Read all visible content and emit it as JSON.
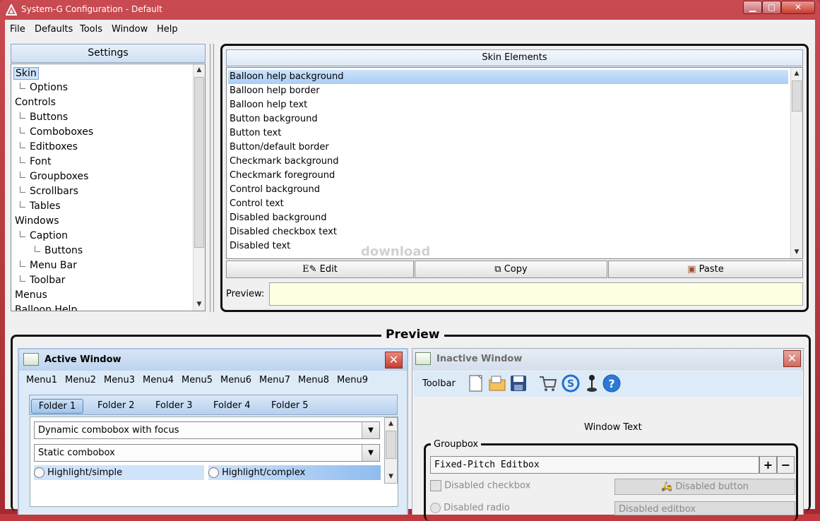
{
  "window": {
    "title": "System-G Configuration - Default"
  },
  "menubar": [
    "File",
    "Defaults",
    "Tools",
    "Window",
    "Help"
  ],
  "settings": {
    "header": "Settings",
    "tree": [
      "Skin",
      "Options",
      "Controls",
      "Buttons",
      "Comboboxes",
      "Editboxes",
      "Font",
      "Groupboxes",
      "Scrollbars",
      "Tables",
      "Windows",
      "Caption",
      "Buttons",
      "Menu Bar",
      "Toolbar",
      "Menus",
      "Balloon Help"
    ],
    "selected": "Skin"
  },
  "skin_elements": {
    "header": "Skin Elements",
    "items": [
      "Balloon help background",
      "Balloon help border",
      "Balloon help text",
      "Button background",
      "Button text",
      "Button/default border",
      "Checkmark background",
      "Checkmark foreground",
      "Control background",
      "Control text",
      "Disabled background",
      "Disabled checkbox text",
      "Disabled text"
    ],
    "selected": "Balloon help background",
    "edit_label": "Edit",
    "copy_label": "Copy",
    "paste_label": "Paste",
    "preview_label": "Preview:",
    "preview_color": "#ffffe1"
  },
  "watermark": "download",
  "preview": {
    "title": "Preview",
    "active_window": {
      "title": "Active Window",
      "menus": [
        "Menu1",
        "Menu2",
        "Menu3",
        "Menu4",
        "Menu5",
        "Menu6",
        "Menu7",
        "Menu8",
        "Menu9"
      ],
      "folders": [
        "Folder 1",
        "Folder 2",
        "Folder 3",
        "Folder 4",
        "Folder 5"
      ],
      "combo_focus": "Dynamic combobox with focus",
      "combo_static": "Static combobox",
      "radio_simple": "Highlight/simple",
      "radio_complex": "Highlight/complex"
    },
    "inactive_window": {
      "title": "Inactive Window",
      "toolbar_label": "Toolbar",
      "window_text": "Window Text",
      "groupbox_title": "Groupbox",
      "editbox_value": "Fixed-Pitch Editbox",
      "plus": "+",
      "minus": "−",
      "disabled_checkbox": "Disabled checkbox",
      "disabled_button": "Disabled button",
      "disabled_radio": "Disabled radio",
      "disabled_editbox": "Disabled editbox"
    }
  },
  "colors": {
    "frame": "#c0393f",
    "selection": "#b5d3f7",
    "accent_blue": "#3c7fd0"
  }
}
